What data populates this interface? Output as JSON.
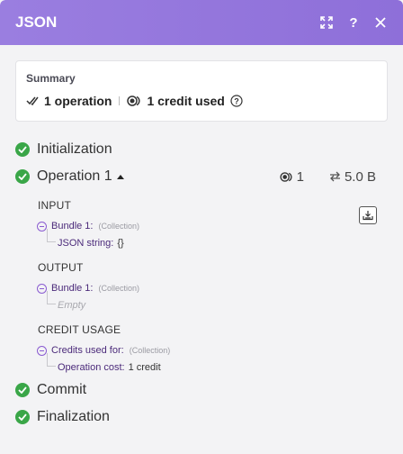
{
  "header": {
    "title": "JSON",
    "expand_icon": "expand-icon",
    "help_icon": "help-icon",
    "close_icon": "close-icon",
    "expand_label": "⤢",
    "help_label": "?",
    "close_label": "✕"
  },
  "summary": {
    "label": "Summary",
    "operations": "1 operation",
    "credits": "1 credit used"
  },
  "steps": {
    "initialization": "Initialization",
    "operation": "Operation 1",
    "operation_ops": "1",
    "operation_size": "5.0 B",
    "commit": "Commit",
    "finalization": "Finalization"
  },
  "details": {
    "input": {
      "title": "INPUT",
      "bundle": "Bundle 1:",
      "bundle_type": "(Collection)",
      "child_key": "JSON string:",
      "child_val": "{}"
    },
    "output": {
      "title": "OUTPUT",
      "bundle": "Bundle 1:",
      "bundle_type": "(Collection)",
      "child_empty": "Empty"
    },
    "credit": {
      "title": "CREDIT USAGE",
      "label": "Credits used for:",
      "label_type": "(Collection)",
      "child_key": "Operation cost:",
      "child_val": "1 credit"
    }
  },
  "colors": {
    "header": "#9a7ee0",
    "success": "#3aa648",
    "collection": "#8a5bd1"
  }
}
